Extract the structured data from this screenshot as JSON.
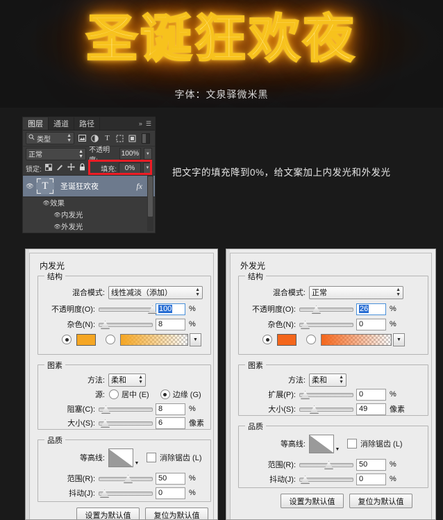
{
  "hero": {
    "title": "圣诞狂欢夜",
    "caption": "字体：文泉驿微米黑",
    "glow_color": "#f7c21d",
    "halo_color": "#ff7a00"
  },
  "annotation": {
    "text": "把文字的填充降到0%，给文案加上内发光和外发光"
  },
  "layers_panel": {
    "tabs": [
      {
        "label": "图层",
        "active": true
      },
      {
        "label": "通道",
        "active": false
      },
      {
        "label": "路径",
        "active": false
      }
    ],
    "collapse_icon": "double-chevron-right-icon",
    "menu_icon": "panel-menu-icon",
    "filter": {
      "search_icon": "search-icon",
      "kind_label": "类型",
      "spinner_icon": "updown-arrows-icon",
      "icons": [
        "pixel-layer-filter-icon",
        "adjustment-layer-filter-icon",
        "type-layer-filter-icon",
        "shape-layer-filter-icon",
        "smart-object-filter-icon"
      ],
      "toggle_icon": "filter-toggle-switch"
    },
    "blend_mode": "正常",
    "opacity_label": "不透明度:",
    "opacity_value": "100%",
    "lock_label": "锁定:",
    "lock_icons": [
      "lock-transparent-pixels-icon",
      "lock-image-pixels-icon",
      "lock-position-icon",
      "lock-all-icon"
    ],
    "fill_label": "填充:",
    "fill_value": "0%",
    "highlight_color": "#ee1c25",
    "layer": {
      "eye_icon": "visibility-eye-icon",
      "thumbnail_glyph": "T",
      "name": "圣诞狂欢夜",
      "fx_badge": "fx",
      "expand_icon": "triangle-up-icon"
    },
    "effects": {
      "group_label": "效果",
      "items": [
        "内发光",
        "外发光"
      ]
    }
  },
  "inner_glow_dialog": {
    "title": "内发光",
    "structure": {
      "label": "结构",
      "blend_mode_label": "混合模式:",
      "blend_mode_value": "线性减淡（添加）",
      "opacity_label": "不透明度(O):",
      "opacity_value": "100",
      "opacity_unit": "%",
      "opacity_pct": 93,
      "noise_label": "杂色(N):",
      "noise_value": "8",
      "noise_unit": "%",
      "noise_pct": 4,
      "color_mode": "solid",
      "solid_color": "#f5a623",
      "gradient_from": "#f5a623",
      "gradient_to": "rgba(245,166,35,0)",
      "gradient_arrow_icon": "chevron-down-icon"
    },
    "elements": {
      "label": "图素",
      "technique_label": "方法:",
      "technique_value": "柔和",
      "source_label": "源:",
      "source_center": "居中 (E)",
      "source_edge": "边缘 (G)",
      "source_selected": "edge",
      "choke_label": "阻塞(C):",
      "choke_value": "8",
      "choke_unit": "%",
      "choke_pct": 5,
      "size_label": "大小(S):",
      "size_value": "6",
      "size_unit": "像素",
      "size_pct": 4
    },
    "quality": {
      "label": "品质",
      "contour_label": "等高线:",
      "contour_arrow_icon": "chevron-down-icon",
      "antialias_label": "消除锯齿 (L)",
      "antialias_checked": false,
      "range_label": "范围(R):",
      "range_value": "50",
      "range_unit": "%",
      "range_pct": 48,
      "jitter_label": "抖动(J):",
      "jitter_value": "0",
      "jitter_unit": "%",
      "jitter_pct": 1
    },
    "buttons": {
      "set_default": "设置为默认值",
      "reset_default": "复位为默认值"
    }
  },
  "outer_glow_dialog": {
    "title": "外发光",
    "structure": {
      "label": "结构",
      "blend_mode_label": "混合模式:",
      "blend_mode_value": "正常",
      "opacity_label": "不透明度(O):",
      "opacity_value": "26",
      "opacity_unit": "%",
      "opacity_pct": 26,
      "noise_label": "杂色(N):",
      "noise_value": "0",
      "noise_unit": "%",
      "noise_pct": 1,
      "color_mode": "solid",
      "solid_color": "#f4661b",
      "gradient_from": "#f4661b",
      "gradient_to": "rgba(244,102,27,0)",
      "gradient_arrow_icon": "chevron-down-icon"
    },
    "elements": {
      "label": "图素",
      "technique_label": "方法:",
      "technique_value": "柔和",
      "spread_label": "扩展(P):",
      "spread_value": "0",
      "spread_unit": "%",
      "spread_pct": 1,
      "size_label": "大小(S):",
      "size_value": "49",
      "size_unit": "像素",
      "size_pct": 21
    },
    "quality": {
      "label": "品质",
      "contour_label": "等高线:",
      "contour_arrow_icon": "chevron-down-icon",
      "antialias_label": "消除锯齿 (L)",
      "antialias_checked": false,
      "range_label": "范围(R):",
      "range_value": "50",
      "range_unit": "%",
      "range_pct": 48,
      "jitter_label": "抖动(J):",
      "jitter_value": "0",
      "jitter_unit": "%",
      "jitter_pct": 1
    },
    "buttons": {
      "set_default": "设置为默认值",
      "reset_default": "复位为默认值"
    }
  }
}
